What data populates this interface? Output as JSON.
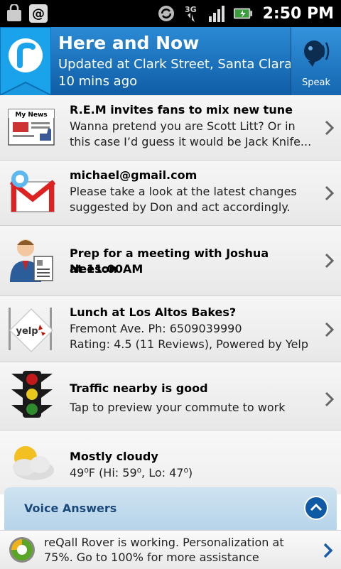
{
  "status_bar": {
    "time": "2:50 PM",
    "network": "3G",
    "icons": [
      "bag-icon",
      "at-icon",
      "sync-icon",
      "3g-icon",
      "signal-icon",
      "battery-icon"
    ]
  },
  "header": {
    "title": "Here and Now",
    "subtitle_line1": "Updated at Clark Street, Santa Clara",
    "subtitle_line2": "10 mins ago",
    "speak_label": "Speak",
    "colors": {
      "bg_top": "#2b8ad4",
      "bg_bottom": "#0f5da6"
    }
  },
  "feed": {
    "items": [
      {
        "icon": "news-icon",
        "title": "R.E.M invites fans to mix new tune",
        "lines": [
          "Wanna pretend you are Scott Litt? Or in",
          "this case I’d guess it would be Jack Knife..."
        ],
        "news_badge": "My News"
      },
      {
        "icon": "gmail-icon",
        "title": "michael@gmail.com",
        "lines": [
          "Please take a look at the latest changes",
          "suggested by Don and act accordingly."
        ]
      },
      {
        "icon": "meeting-icon",
        "title_line1": "Prep for a meeting with Joshua Neeson",
        "title_line2": "at 11:00AM"
      },
      {
        "icon": "yelp-icon",
        "title": "Lunch at Los Altos Bakes?",
        "lines": [
          "Fremont Ave. Ph: 6509039990",
          "Rating: 4.5 (11 Reviews), Powered by Yelp"
        ],
        "yelp_label": "yelp"
      },
      {
        "icon": "traffic-light-icon",
        "title": "Traffic nearby is good",
        "lines": [
          "Tap to preview your commute to work"
        ]
      },
      {
        "icon": "cloud-icon",
        "title": "Mostly cloudy",
        "lines": [
          "49⁰F (Hi: 59⁰, Lo: 47⁰)"
        ]
      }
    ]
  },
  "voice_answers": {
    "label": "Voice Answers"
  },
  "bottom_bar": {
    "message": "reQall Rover is working. Personalization at 75%. Go to 100% for more assistance",
    "personalization_pct": 75
  }
}
